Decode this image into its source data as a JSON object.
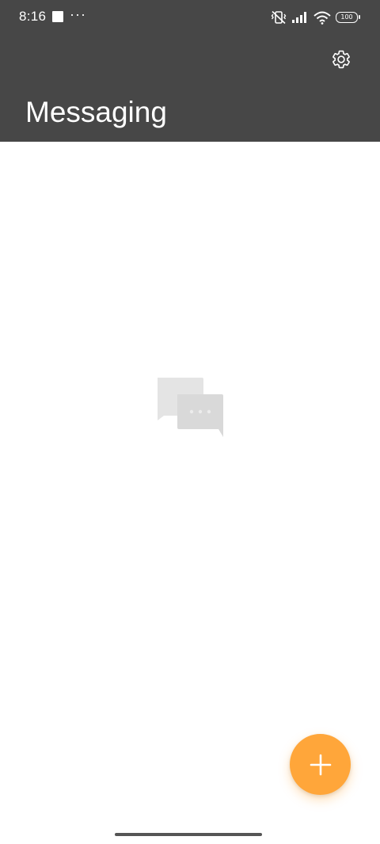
{
  "status_bar": {
    "time": "8:16",
    "more": "···",
    "battery": "100",
    "icons": [
      "stop-square-icon",
      "more-dots-icon",
      "vibrate-off-icon",
      "signal-icon",
      "wifi-icon",
      "battery-icon"
    ]
  },
  "header": {
    "title": "Messaging",
    "settings_icon": "gear-icon",
    "background": "#474747"
  },
  "empty_state": {
    "icon": "chat-bubbles-icon"
  },
  "fab": {
    "icon": "plus-icon",
    "color": "#ffa63a"
  }
}
